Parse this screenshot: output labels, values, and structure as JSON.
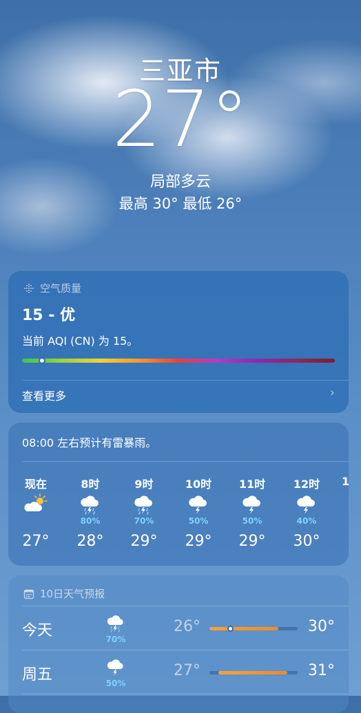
{
  "hero": {
    "city": "三亚市",
    "temperature": "27°",
    "condition": "局部多云",
    "high_low": "最高 30°  最低 26°"
  },
  "air_quality": {
    "title": "空气质量",
    "icon": "air-quality-icon",
    "value": "15 - 优",
    "description": "当前 AQI (CN) 为 15。",
    "level_fraction": 0.03,
    "see_more": "查看更多"
  },
  "hourly": {
    "note": "08:00 左右预计有雷暴雨。",
    "items": [
      {
        "time": "现在",
        "icon": "partly-sunny-icon",
        "precip": "",
        "temp": "27°"
      },
      {
        "time": "8时",
        "icon": "thunderstorm-icon",
        "precip": "80%",
        "temp": "28°"
      },
      {
        "time": "9时",
        "icon": "thunderstorm-icon",
        "precip": "70%",
        "temp": "29°"
      },
      {
        "time": "10时",
        "icon": "thunder-cloud-icon",
        "precip": "50%",
        "temp": "29°"
      },
      {
        "time": "11时",
        "icon": "thunder-cloud-icon",
        "precip": "50%",
        "temp": "29°"
      },
      {
        "time": "12时",
        "icon": "thunder-cloud-icon",
        "precip": "40%",
        "temp": "30°"
      }
    ]
  },
  "daily": {
    "title": "10日天气预报",
    "icon": "calendar-icon",
    "items": [
      {
        "day": "今天",
        "icon": "thunderstorm-icon",
        "precip": "70%",
        "low": "26°",
        "high": "30°"
      },
      {
        "day": "周五",
        "icon": "thunder-cloud-icon",
        "precip": "50%",
        "low": "27°",
        "high": "31°"
      }
    ]
  },
  "colors": {
    "precip": "#7fd1ff",
    "sun": "#f7c43b",
    "temp_bar": "#f08a2a"
  }
}
